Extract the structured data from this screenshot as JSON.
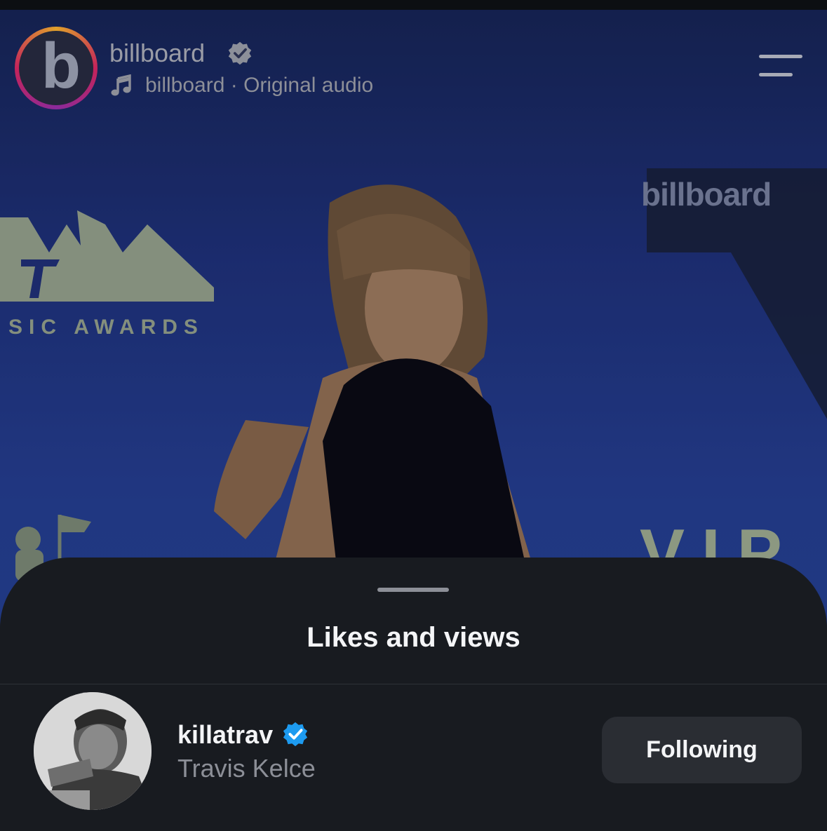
{
  "post": {
    "account_name": "billboard",
    "audio_line": "billboard · Original audio",
    "logo_letter": "b",
    "logo_side_text": "billboard",
    "verified_icon": "verified-badge-icon",
    "music_icon": "music-note-icon",
    "menu_icon": "hamburger-menu-icon"
  },
  "video": {
    "backdrop_awards_text": "SIC AWARDS",
    "backdrop_logo_text": "billboard",
    "backdrop_vip_text": "VIP"
  },
  "sheet": {
    "title": "Likes and views",
    "users": [
      {
        "username": "killatrav",
        "full_name": "Travis Kelce",
        "button_label": "Following",
        "verified": true
      }
    ]
  },
  "colors": {
    "verified_blue": "#1d9bf0",
    "sheet_bg": "#181b20",
    "button_bg": "#2a2d33"
  }
}
